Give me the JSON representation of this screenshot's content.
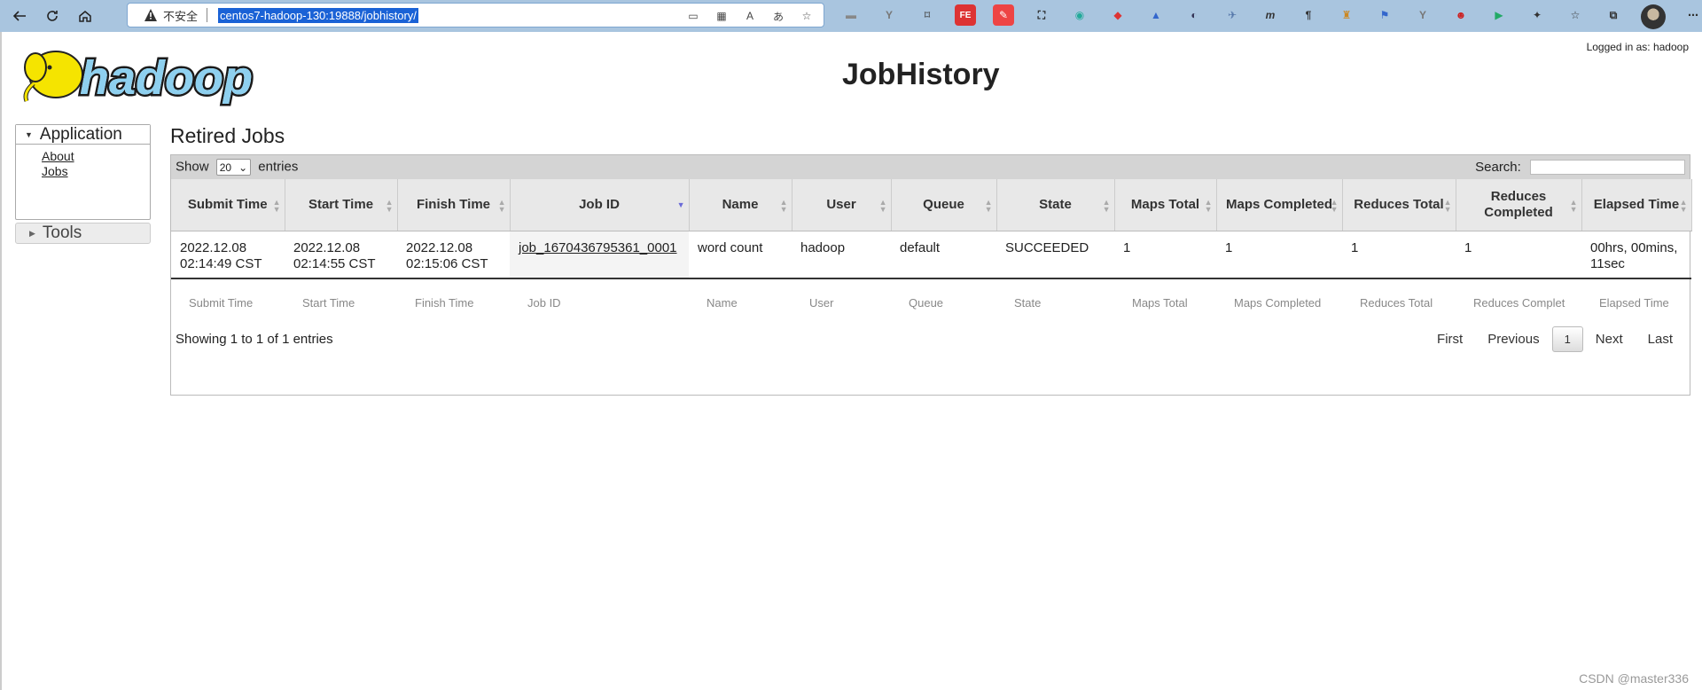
{
  "browser": {
    "insecure_label": "不安全",
    "url": "centos7-hadoop-130:19888/jobhistory/"
  },
  "header": {
    "logged_in": "Logged in as: hadoop",
    "title": "JobHistory",
    "logo_text": "hadoop"
  },
  "sidebar": {
    "application_label": "Application",
    "links": [
      "About",
      "Jobs"
    ],
    "tools_label": "Tools"
  },
  "main": {
    "section_title": "Retired Jobs",
    "show_label": "Show",
    "show_value": "20",
    "entries_label": "entries",
    "search_label": "Search:",
    "columns": [
      "Submit Time",
      "Start Time",
      "Finish Time",
      "Job ID",
      "Name",
      "User",
      "Queue",
      "State",
      "Maps Total",
      "Maps Completed",
      "Reduces Total",
      "Reduces Completed",
      "Elapsed Time"
    ],
    "rows": [
      [
        "2022.12.08 02:14:49 CST",
        "2022.12.08 02:14:55 CST",
        "2022.12.08 02:15:06 CST",
        "job_1670436795361_0001",
        "word count",
        "hadoop",
        "default",
        "SUCCEEDED",
        "1",
        "1",
        "1",
        "1",
        "00hrs, 00mins, 11sec"
      ]
    ],
    "footer_columns": [
      "Submit Time",
      "Start Time",
      "Finish Time",
      "Job ID",
      "Name",
      "User",
      "Queue",
      "State",
      "Maps Total",
      "Maps Completed",
      "Reduces Total",
      "Reduces Complet",
      "Elapsed Time"
    ],
    "info": "Showing 1 to 1 of 1 entries",
    "pager": {
      "first": "First",
      "previous": "Previous",
      "current": "1",
      "next": "Next",
      "last": "Last"
    }
  },
  "watermark": "CSDN @master336"
}
